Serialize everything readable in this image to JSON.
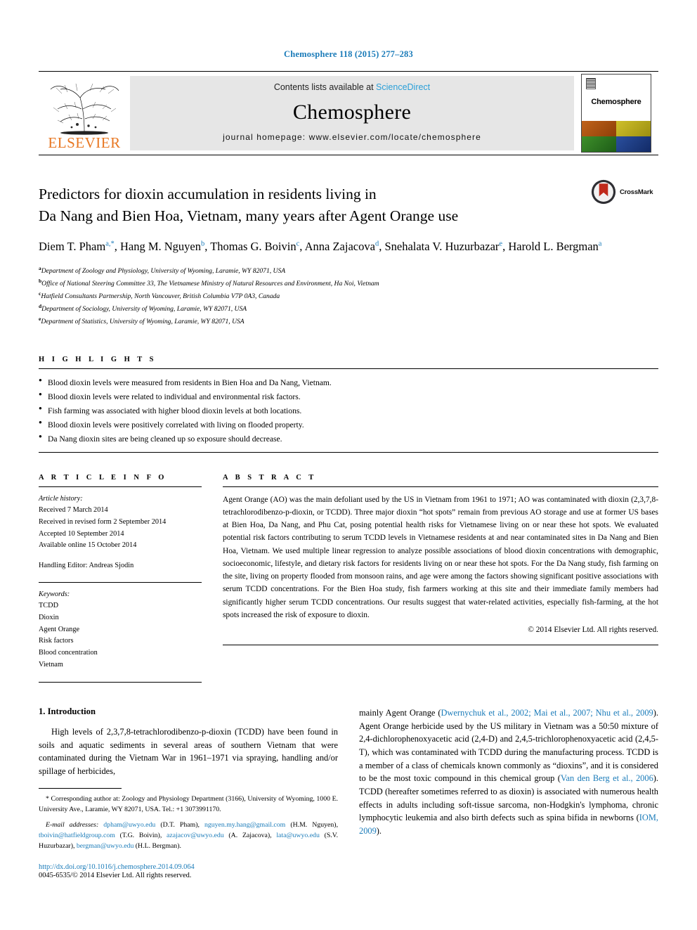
{
  "running_head": "Chemosphere 118 (2015) 277–283",
  "header": {
    "contents_prefix": "Contents lists available at ",
    "sciencedirect": "ScienceDirect",
    "journal_title": "Chemosphere",
    "homepage": "journal homepage: www.elsevier.com/locate/chemosphere",
    "publisher_name": "ELSEVIER",
    "cover_name": "Chemosphere",
    "cover_colors": [
      "#b5560f",
      "#c8b91a",
      "#2f7a23",
      "#1f3f8f"
    ],
    "link_color": "#2a9fd8",
    "band_color": "#e6e6e6",
    "elsevier_orange": "#E87722"
  },
  "article": {
    "title_line1": "Predictors for dioxin accumulation in residents living in",
    "title_line2": "Da Nang and Bien Hoa, Vietnam, many years after Agent Orange use",
    "crossmark_label": "CrossMark",
    "authors": [
      {
        "name": "Diem T. Pham",
        "sup": "a,*"
      },
      {
        "name": "Hang M. Nguyen",
        "sup": "b"
      },
      {
        "name": "Thomas G. Boivin",
        "sup": "c"
      },
      {
        "name": "Anna Zajacova",
        "sup": "d"
      },
      {
        "name": "Snehalata V. Huzurbazar",
        "sup": "e"
      },
      {
        "name": "Harold L. Bergman",
        "sup": "a"
      }
    ],
    "affiliations": [
      {
        "sup": "a",
        "text": "Department of Zoology and Physiology, University of Wyoming, Laramie, WY 82071, USA"
      },
      {
        "sup": "b",
        "text": "Office of National Steering Committee 33, The Vietnamese Ministry of Natural Resources and Environment, Ha Noi, Vietnam"
      },
      {
        "sup": "c",
        "text": "Hatfield Consultants Partnership, North Vancouver, British Columbia V7P 0A3, Canada"
      },
      {
        "sup": "d",
        "text": "Department of Sociology, University of Wyoming, Laramie, WY 82071, USA"
      },
      {
        "sup": "e",
        "text": "Department of Statistics, University of Wyoming, Laramie, WY 82071, USA"
      }
    ]
  },
  "highlights": {
    "label": "H I G H L I G H T S",
    "items": [
      "Blood dioxin levels were measured from residents in Bien Hoa and Da Nang, Vietnam.",
      "Blood dioxin levels were related to individual and environmental risk factors.",
      "Fish farming was associated with higher blood dioxin levels at both locations.",
      "Blood dioxin levels were positively correlated with living on flooded property.",
      "Da Nang dioxin sites are being cleaned up so exposure should decrease."
    ]
  },
  "article_info": {
    "label": "A R T I C L E  I N F O",
    "history_title": "Article history:",
    "history": [
      "Received 7 March 2014",
      "Received in revised form 2 September 2014",
      "Accepted 10 September 2014",
      "Available online 15 October 2014"
    ],
    "handling_editor": "Handling Editor: Andreas Sjodin",
    "keywords_title": "Keywords:",
    "keywords": [
      "TCDD",
      "Dioxin",
      "Agent Orange",
      "Risk factors",
      "Blood concentration",
      "Vietnam"
    ]
  },
  "abstract": {
    "label": "A B S T R A C T",
    "text": "Agent Orange (AO) was the main defoliant used by the US in Vietnam from 1961 to 1971; AO was contaminated with dioxin (2,3,7,8-tetrachlorodibenzo-p-dioxin, or TCDD). Three major dioxin “hot spots” remain from previous AO storage and use at former US bases at Bien Hoa, Da Nang, and Phu Cat, posing potential health risks for Vietnamese living on or near these hot spots. We evaluated potential risk factors contributing to serum TCDD levels in Vietnamese residents at and near contaminated sites in Da Nang and Bien Hoa, Vietnam. We used multiple linear regression to analyze possible associations of blood dioxin concentrations with demographic, socioeconomic, lifestyle, and dietary risk factors for residents living on or near these hot spots. For the Da Nang study, fish farming on the site, living on property flooded from monsoon rains, and age were among the factors showing significant positive associations with serum TCDD concentrations. For the Bien Hoa study, fish farmers working at this site and their immediate family members had significantly higher serum TCDD concentrations. Our results suggest that water-related activities, especially fish-farming, at the hot spots increased the risk of exposure to dioxin.",
    "copyright": "© 2014 Elsevier Ltd. All rights reserved."
  },
  "introduction": {
    "heading": "1. Introduction",
    "left_para": "High levels of 2,3,7,8-tetrachlorodibenzo-p-dioxin (TCDD) have been found in soils and aquatic sediments in several areas of southern Vietnam that were contaminated during the Vietnam War in 1961–1971 via spraying, handling and/or spillage of herbicides,",
    "right_para_1a": "mainly Agent Orange (",
    "right_cite_1": "Dwernychuk et al., 2002; Mai et al., 2007; Nhu et al., 2009",
    "right_para_1b": "). Agent Orange herbicide used by the US military in Vietnam was a 50:50 mixture of 2,4-dichlorophenoxyacetic acid (2,4-D) and 2,4,5-trichlorophenoxyacetic acid (2,4,5-T), which was contaminated with TCDD during the manufacturing process. TCDD is a member of a class of chemicals known commonly as “dioxins”, and it is considered to be the most toxic compound in this chemical group (",
    "right_cite_2": "Van den Berg et al., 2006",
    "right_para_1c": "). TCDD (hereafter sometimes referred to as dioxin) is associated with numerous health effects in adults including soft-tissue sarcoma, non-Hodgkin's lymphoma, chronic lymphocytic leukemia and also birth defects such as spina bifida in newborns (",
    "right_cite_3": "IOM, 2009",
    "right_para_1d": ")."
  },
  "footnotes": {
    "corresponding_marker": "*",
    "corresponding_text": "Corresponding author at: Zoology and Physiology Department (3166), University of Wyoming, 1000 E. University Ave., Laramie, WY 82071, USA. Tel.: +1 3073991170.",
    "email_label": "E-mail addresses:",
    "emails": [
      {
        "address": "dpham@uwyo.edu",
        "person": "(D.T. Pham)"
      },
      {
        "address": "nguyen.my.hang@gmail.com",
        "person": "(H.M. Nguyen)"
      },
      {
        "address": "tboivin@hatfieldgroup.com",
        "person": "(T.G. Boivin)"
      },
      {
        "address": "azajacov@uwyo.edu",
        "person": "(A. Zajacova)"
      },
      {
        "address": "lata@uwyo.edu",
        "person": "(S.V. Huzurbazar)"
      },
      {
        "address": "bergman@uwyo.edu",
        "person": "(H.L. Bergman)"
      }
    ],
    "doi": "http://dx.doi.org/10.1016/j.chemosphere.2014.09.064",
    "issn_copyright": "0045-6535/© 2014 Elsevier Ltd. All rights reserved."
  }
}
